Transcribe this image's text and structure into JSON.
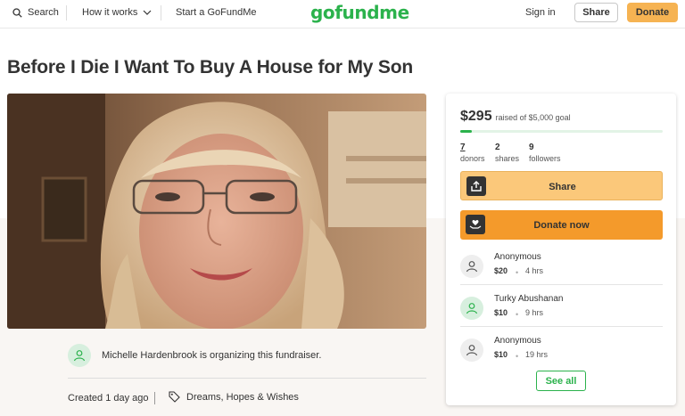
{
  "header": {
    "search_label": "Search",
    "how_it_works_label": "How it works",
    "start_label": "Start a GoFundMe",
    "logo_text": "gofundme",
    "signin_label": "Sign in",
    "share_label": "Share",
    "donate_label": "Donate"
  },
  "campaign": {
    "title": "Before I Die I Want To Buy A House for My Son",
    "organizer_text": "Michelle Hardenbrook is organizing this fundraiser.",
    "created_text": "Created 1 day ago",
    "category": "Dreams, Hopes & Wishes"
  },
  "sidebar": {
    "raised_amount": "$295",
    "raised_goal_text": "raised of $5,000 goal",
    "progress_fraction": 0.059,
    "stats": {
      "donors_count": "7",
      "donors_label": "donors",
      "shares_count": "2",
      "shares_label": "shares",
      "followers_count": "9",
      "followers_label": "followers"
    },
    "share_button_label": "Share",
    "donate_button_label": "Donate now",
    "donations": [
      {
        "name": "Anonymous",
        "amount": "$20",
        "time": "4 hrs",
        "avatar": "grey"
      },
      {
        "name": "Turky Abushanan",
        "amount": "$10",
        "time": "9 hrs",
        "avatar": "green"
      },
      {
        "name": "Anonymous",
        "amount": "$10",
        "time": "19 hrs",
        "avatar": "grey"
      }
    ],
    "see_all_label": "See all"
  },
  "colors": {
    "brand_green": "#2bb24c",
    "donate_orange": "#f49a2b",
    "share_orange": "#fbc87a"
  }
}
